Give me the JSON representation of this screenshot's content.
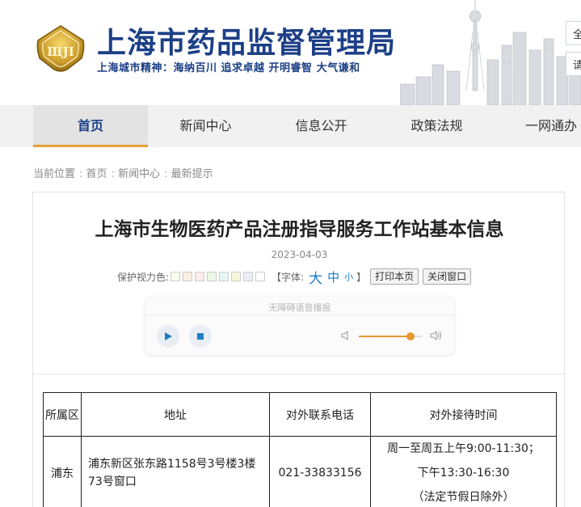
{
  "header": {
    "logo_text": "ЩJI",
    "title": "上海市药品监督管理局",
    "slogan": "上海城市精神：海纳百川  追求卓越  开明睿智  大气谦和",
    "side_buttons": [
      "全",
      "请"
    ]
  },
  "nav": {
    "items": [
      "首页",
      "新闻中心",
      "信息公开",
      "政策法规",
      "一网通办"
    ]
  },
  "breadcrumb": {
    "label": "当前位置",
    "items": [
      "首页",
      "新闻中心",
      "最新提示"
    ]
  },
  "article": {
    "title": "上海市生物医药产品注册指导服务工作站基本信息",
    "date": "2023-04-03",
    "tools": {
      "eye_color_label": "保护视力色:",
      "eye_colors": [
        "#fbfbed",
        "#fbefe3",
        "#fdeaea",
        "#eef6e4",
        "#e6f6f4",
        "#f4f7d9",
        "#edeef5",
        "#ffffff"
      ],
      "font_label": "【字体:",
      "font_big": "大",
      "font_mid": "中",
      "font_small": "小",
      "font_end": "】",
      "print_button": "打印本页",
      "close_button": "关闭窗口"
    },
    "player": {
      "label": "无障碍语音播报",
      "volume": 0.82
    },
    "table": {
      "headers": [
        "所属区",
        "地址",
        "对外联系电话",
        "对外接待时间"
      ],
      "rows": [
        {
          "district": "浦东",
          "address": "浦东新区张东路1158号3号楼3楼73号窗口",
          "phone": "021-33833156",
          "hours": [
            "周一至周五上午9:00-11:30；",
            "下午13:30-16:30",
            "（法定节假日除外）"
          ]
        }
      ]
    }
  },
  "colors": {
    "brand_blue": "#1c3f86",
    "accent_orange": "#e9a23b",
    "nav_bg": "#f1f1f1"
  }
}
